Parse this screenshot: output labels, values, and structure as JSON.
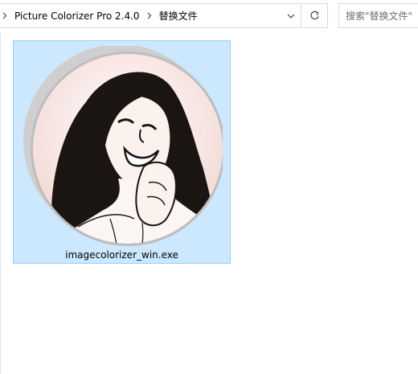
{
  "address_bar": {
    "breadcrumbs": [
      "Picture Colorizer Pro 2.4.0",
      "替换文件"
    ],
    "dropdown_icon": "chevron-down-icon",
    "refresh_icon": "refresh-icon"
  },
  "search": {
    "placeholder": "搜索\"替换文件\"",
    "value": ""
  },
  "files": [
    {
      "name": "imagecolorizer_win.exe",
      "icon": "app-icon-portrait",
      "selected": true
    }
  ],
  "colors": {
    "selection_fill": "#cce8ff",
    "selection_border": "#99d1ff",
    "border": "#d9d9d9"
  }
}
